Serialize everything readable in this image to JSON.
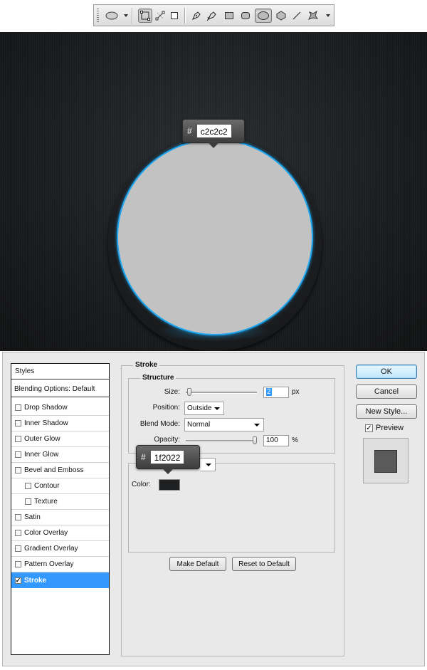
{
  "toolbar": {
    "tools": [
      {
        "icon": "ellipse-tool-icon",
        "has_dropdown": true
      },
      {
        "icon": "shape-layers-icon",
        "active": true
      },
      {
        "icon": "paths-icon"
      },
      {
        "icon": "fill-pixels-icon"
      },
      {
        "icon": "pen-icon"
      },
      {
        "icon": "freeform-pen-icon"
      },
      {
        "icon": "rectangle-icon"
      },
      {
        "icon": "rounded-rectangle-icon"
      },
      {
        "icon": "ellipse-icon",
        "active": true
      },
      {
        "icon": "polygon-icon"
      },
      {
        "icon": "line-icon"
      },
      {
        "icon": "custom-shape-icon",
        "has_dropdown": true
      }
    ]
  },
  "canvas": {
    "top_tooltip": {
      "hash": "#",
      "hex": "c2c2c2"
    },
    "colors": {
      "fill": "#c2c2c2",
      "glow": "#1fa6ee"
    }
  },
  "dialog": {
    "styles_header": "Styles",
    "blending_options": "Blending Options: Default",
    "effects": [
      {
        "label": "Drop Shadow",
        "checked": false
      },
      {
        "label": "Inner Shadow",
        "checked": false
      },
      {
        "label": "Outer Glow",
        "checked": false
      },
      {
        "label": "Inner Glow",
        "checked": false
      },
      {
        "label": "Bevel and Emboss",
        "checked": false
      },
      {
        "label": "Contour",
        "checked": false,
        "sub": true
      },
      {
        "label": "Texture",
        "checked": false,
        "sub": true
      },
      {
        "label": "Satin",
        "checked": false
      },
      {
        "label": "Color Overlay",
        "checked": false
      },
      {
        "label": "Gradient Overlay",
        "checked": false
      },
      {
        "label": "Pattern Overlay",
        "checked": false
      },
      {
        "label": "Stroke",
        "checked": true,
        "selected": true
      }
    ],
    "stroke": {
      "group_title": "Stroke",
      "structure_title": "Structure",
      "size_label": "Size:",
      "size_value": "2",
      "size_unit": "px",
      "size_fraction": 0.02,
      "position_label": "Position:",
      "position_value": "Outside",
      "blend_label": "Blend Mode:",
      "blend_value": "Normal",
      "opacity_label": "Opacity:",
      "opacity_value": "100",
      "opacity_unit": "%",
      "opacity_fraction": 1.0,
      "color_label": "Color:",
      "color_value": "#1f2022"
    },
    "color_tooltip": {
      "hash": "#",
      "hex": "1f2022"
    },
    "buttons": {
      "make_default": "Make Default",
      "reset_default": "Reset to Default",
      "ok": "OK",
      "cancel": "Cancel",
      "new_style": "New Style...",
      "preview_label": "Preview",
      "preview_checked": true
    }
  }
}
